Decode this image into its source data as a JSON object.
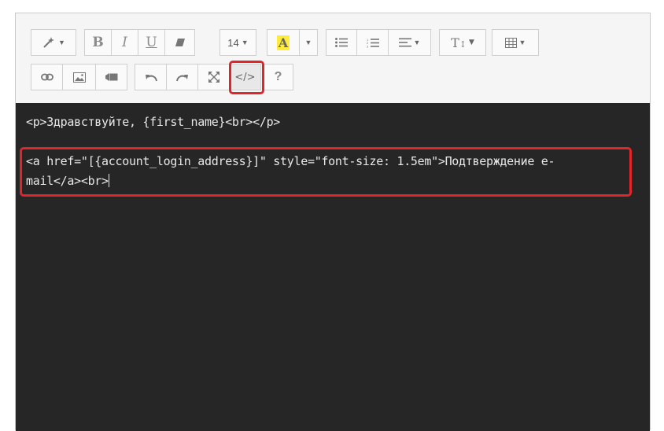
{
  "toolbar": {
    "font_size": "14",
    "color_glyph": "A",
    "style_glyph": "T",
    "help_glyph": "?",
    "code_view_glyph": "</>"
  },
  "code": {
    "line1": "<p>Здравствуйте, {first_name}<br></p>",
    "line2": "<a href=\"[{account_login_address}]\" style=\"font-size: 1.5em\">Подтверждение e-",
    "line3": "mail</a><br>"
  },
  "colors": {
    "highlight": "#e0262b",
    "code_bg": "#262626",
    "color_swatch": "#ffeb3b"
  }
}
